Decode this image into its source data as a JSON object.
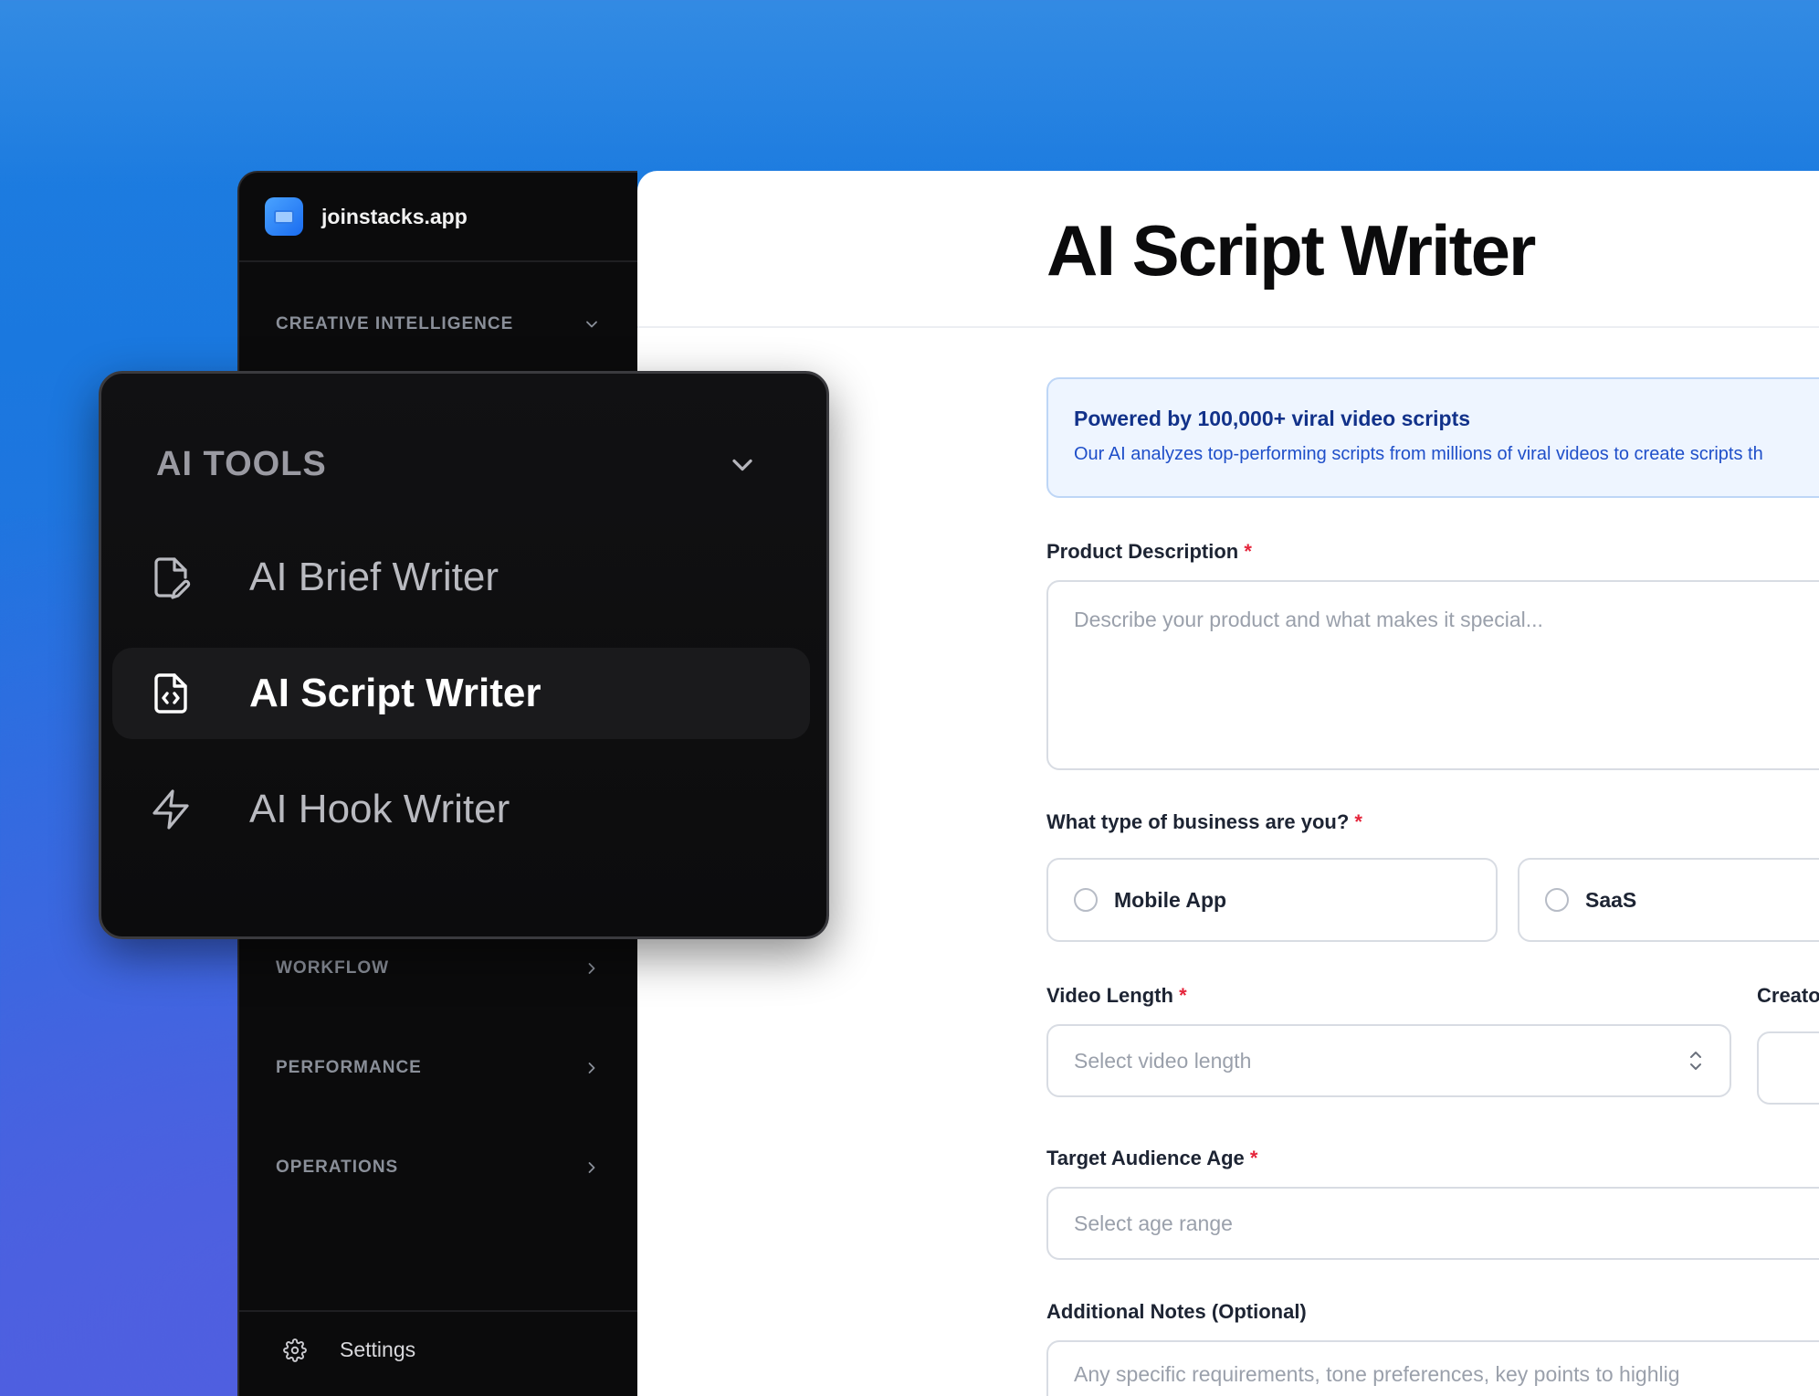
{
  "app": {
    "name": "joinstacks.app"
  },
  "sidebar": {
    "sections": [
      {
        "label": "CREATIVE INTELLIGENCE",
        "state": "expanded"
      },
      {
        "label": "WORKFLOW",
        "state": "collapsed"
      },
      {
        "label": "PERFORMANCE",
        "state": "collapsed"
      },
      {
        "label": "OPERATIONS",
        "state": "collapsed"
      }
    ],
    "settings_label": "Settings"
  },
  "popover": {
    "title": "AI TOOLS",
    "items": [
      {
        "label": "AI Brief Writer",
        "icon": "file-pen-icon",
        "active": false
      },
      {
        "label": "AI Script Writer",
        "icon": "file-code-icon",
        "active": true
      },
      {
        "label": "AI Hook Writer",
        "icon": "zap-icon",
        "active": false
      }
    ]
  },
  "main": {
    "title": "AI Script Writer",
    "info": {
      "title": "Powered by 100,000+ viral video scripts",
      "text": "Our AI analyzes top-performing scripts from millions of viral videos to create scripts th"
    },
    "product_description": {
      "label": "Product Description",
      "required": "*",
      "placeholder": "Describe your product and what makes it special..."
    },
    "business_type": {
      "label": "What type of business are you?",
      "required": "*",
      "options": [
        "Mobile App",
        "SaaS"
      ]
    },
    "video_length": {
      "label": "Video Length",
      "required": "*",
      "placeholder": "Select video length"
    },
    "creator_label": "Creato",
    "audience_age": {
      "label": "Target Audience Age",
      "required": "*",
      "placeholder": "Select age range"
    },
    "notes": {
      "label": "Additional Notes (Optional)",
      "placeholder": "Any specific requirements, tone preferences, key points to highlig"
    }
  },
  "colors": {
    "accent": "#1a78df",
    "required": "#e5253b",
    "info_bg": "#eef5ff",
    "sidebar_bg": "#0b0b0c"
  }
}
